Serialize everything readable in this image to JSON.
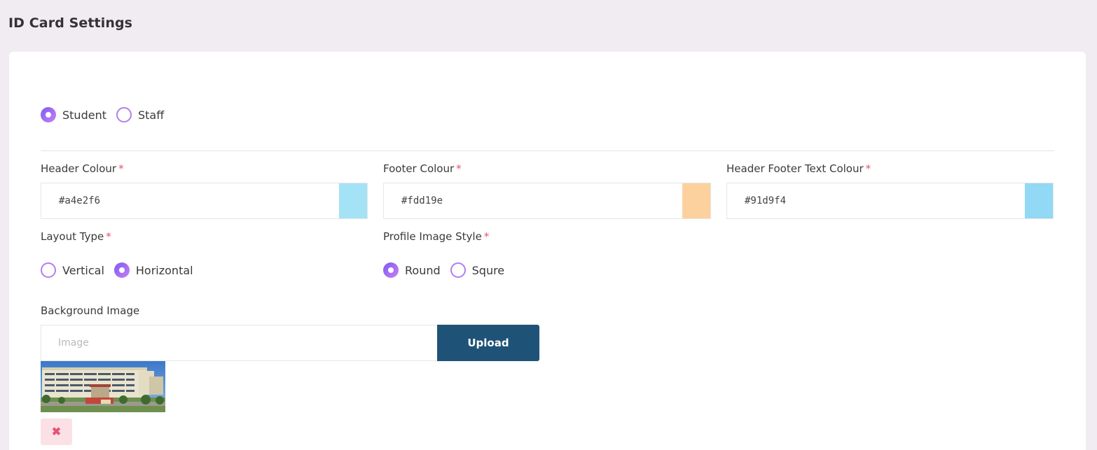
{
  "page": {
    "title": "ID Card Settings"
  },
  "card_type": {
    "options": [
      {
        "label": "Student",
        "checked": true
      },
      {
        "label": "Staff",
        "checked": false
      }
    ]
  },
  "header_colour": {
    "label": "Header Colour",
    "required": "*",
    "value": "#a4e2f6",
    "swatch": "#a4e2f6"
  },
  "footer_colour": {
    "label": "Footer Colour",
    "required": "*",
    "value": "#fdd19e",
    "swatch": "#fdd19e"
  },
  "text_colour": {
    "label": "Header Footer Text Colour",
    "required": "*",
    "value": "#91d9f4",
    "swatch": "#91d9f4"
  },
  "layout_type": {
    "label": "Layout Type",
    "required": "*",
    "options": [
      {
        "label": "Vertical",
        "checked": false
      },
      {
        "label": "Horizontal",
        "checked": true
      }
    ]
  },
  "profile_image_style": {
    "label": "Profile Image Style",
    "required": "*",
    "options": [
      {
        "label": "Round",
        "checked": true
      },
      {
        "label": "Squre",
        "checked": false
      }
    ]
  },
  "background_image": {
    "label": "Background Image",
    "placeholder": "Image",
    "value": "",
    "upload_label": "Upload",
    "remove_icon": "close-icon"
  },
  "colors": {
    "accent": "#b27ef0",
    "upload_button": "#1f5277",
    "required": "#e2566d",
    "remove_bg": "#fbe1e6",
    "remove_fg": "#e65474"
  }
}
